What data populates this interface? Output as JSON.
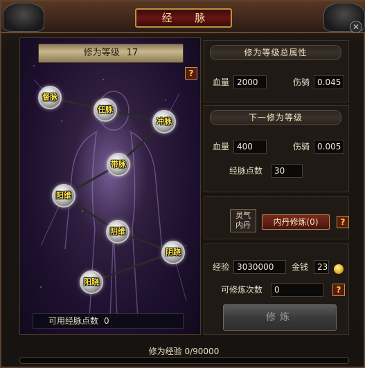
{
  "window": {
    "title": "经 脉",
    "close_label": "✕"
  },
  "left": {
    "cultivation_label": "修为等级",
    "cultivation_level": "17",
    "help_label": "?",
    "available_points_label": "可用经脉点数",
    "available_points_value": "0",
    "nodes": [
      {
        "label": "督脉"
      },
      {
        "label": "任脉"
      },
      {
        "label": "冲脉"
      },
      {
        "label": "带脉"
      },
      {
        "label": "阳维"
      },
      {
        "label": "阴维"
      },
      {
        "label": "阴跷"
      },
      {
        "label": "阳跷"
      }
    ]
  },
  "total_attrs": {
    "header": "修为等级总属性",
    "hp_label": "血量",
    "hp_value": "2000",
    "dmg_label": "伤骑",
    "dmg_value": "0.045"
  },
  "next_level": {
    "header": "下一修为等级",
    "hp_label": "血量",
    "hp_value": "400",
    "dmg_label": "伤骑",
    "dmg_value": "0.005",
    "points_label": "经脉点数",
    "points_value": "30"
  },
  "inner_dan": {
    "spirit_label_1": "灵气",
    "spirit_label_2": "内丹",
    "refine_dan_label": "内丹修炼(0)",
    "help_label": "?"
  },
  "refine": {
    "exp_label": "经验",
    "exp_value": "3030000",
    "gold_label": "金钱",
    "gold_value": "23",
    "times_label": "可修炼次数",
    "times_value": "0",
    "help_label": "?",
    "button_label": "修炼"
  },
  "xp": {
    "label": "修为经验 0/90000",
    "progress": 0
  },
  "colors": {
    "accent_gold": "#b8953e",
    "title_red": "#6a1414",
    "node_text": "#ffe44a"
  }
}
